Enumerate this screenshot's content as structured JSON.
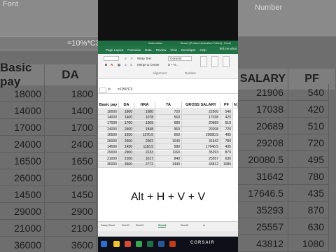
{
  "left_background": {
    "font_label": "Font",
    "formula_text": "=10%*C3",
    "headers": [
      "Basic pay",
      "DA"
    ],
    "rows": [
      [
        "18000",
        "1800"
      ],
      [
        "14000",
        "1400"
      ],
      [
        "17000",
        "1700"
      ],
      [
        "24000",
        "2400"
      ],
      [
        "16500",
        "1650"
      ],
      [
        "26000",
        "2600"
      ],
      [
        "14500",
        "1450"
      ],
      [
        "29000",
        "2900"
      ],
      [
        "21000",
        "2100"
      ],
      [
        "36000",
        "3600"
      ]
    ]
  },
  "right_background": {
    "number_label": "Number",
    "headers": [
      "SALARY",
      "PF"
    ],
    "rows": [
      [
        "21906",
        "540"
      ],
      [
        "17038",
        "420"
      ],
      [
        "20689",
        "510"
      ],
      [
        "29208",
        "720"
      ],
      [
        "20080.5",
        "495"
      ],
      [
        "31642",
        "780"
      ],
      [
        "17646.5",
        "435"
      ],
      [
        "35293",
        "870"
      ],
      [
        "25557",
        "630"
      ],
      [
        "43812",
        "1080"
      ]
    ]
  },
  "excel": {
    "title": "Book1 [Product Activation Failed] - Excel",
    "title_left": "Automation",
    "ribbon_tabs": [
      "Page Layout",
      "Formulas",
      "Data",
      "Review",
      "View",
      "Developer",
      "Help"
    ],
    "tell_me": "Tell me what",
    "ribbon": {
      "wrap_text": "Wrap Text",
      "merge_center": "Merge & Center",
      "number_format": "General",
      "alignment_group": "Alignment",
      "number_group": "Number"
    },
    "formula": {
      "fx": "fx",
      "content": "=10%*C3"
    },
    "headers": [
      "Basic pay",
      "DA",
      "HRA",
      "TA",
      "GROSS SALARY",
      "PF",
      "N"
    ],
    "rows": [
      [
        "18000",
        "1800",
        "1980",
        "720",
        "22500",
        "540"
      ],
      [
        "14000",
        "1400",
        "1078",
        "560",
        "17038",
        "420"
      ],
      [
        "17000",
        "1700",
        "1309",
        "680",
        "20689",
        "510"
      ],
      [
        "24000",
        "2400",
        "1848",
        "960",
        "29208",
        "720"
      ],
      [
        "16500",
        "1650",
        "1270.5",
        "660",
        "20080.5",
        "495"
      ],
      [
        "26000",
        "2600",
        "2002",
        "1040",
        "31642",
        "780"
      ],
      [
        "14500",
        "1450",
        "1116.5",
        "580",
        "17646.5",
        "435"
      ],
      [
        "29000",
        "2900",
        "2233",
        "1160",
        "35293",
        "870"
      ],
      [
        "21000",
        "2100",
        "1617",
        "840",
        "25557",
        "630"
      ],
      [
        "36000",
        "3600",
        "2772",
        "1440",
        "43812",
        "1080"
      ]
    ],
    "shortcut": "Alt + H + V + V",
    "sheet_tabs": [
      "Salary Sheet",
      "Sheet2",
      "Sheet3",
      "Sheet4",
      "Sheet5"
    ],
    "active_sheet_index": 3
  },
  "brand": "CORSAIR",
  "colors": {
    "excel_green": "#227447",
    "title_green": "#1f6e43"
  }
}
